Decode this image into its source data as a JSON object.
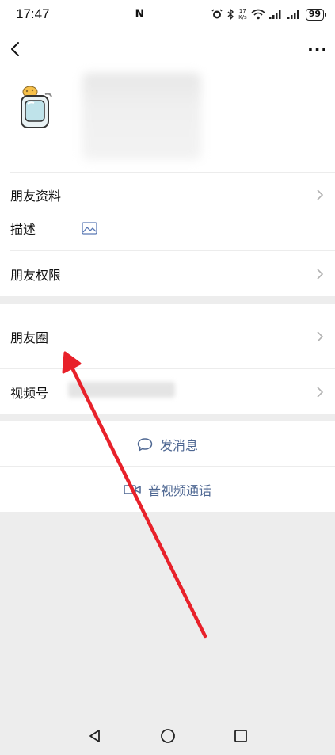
{
  "status_bar": {
    "time": "17:47",
    "nfc": "N",
    "netspeed_value": "17",
    "netspeed_unit": "K/s",
    "battery": "99"
  },
  "header": {
    "more_label": "···"
  },
  "rows": {
    "profile": "朋友资料",
    "description": "描述",
    "permissions": "朋友权限",
    "moments": "朋友圈",
    "channels": "视频号"
  },
  "actions": {
    "message": "发消息",
    "call": "音视频通话"
  },
  "colors": {
    "action_text": "#4e6792",
    "arrow": "#e8212a",
    "background": "#ededed"
  }
}
